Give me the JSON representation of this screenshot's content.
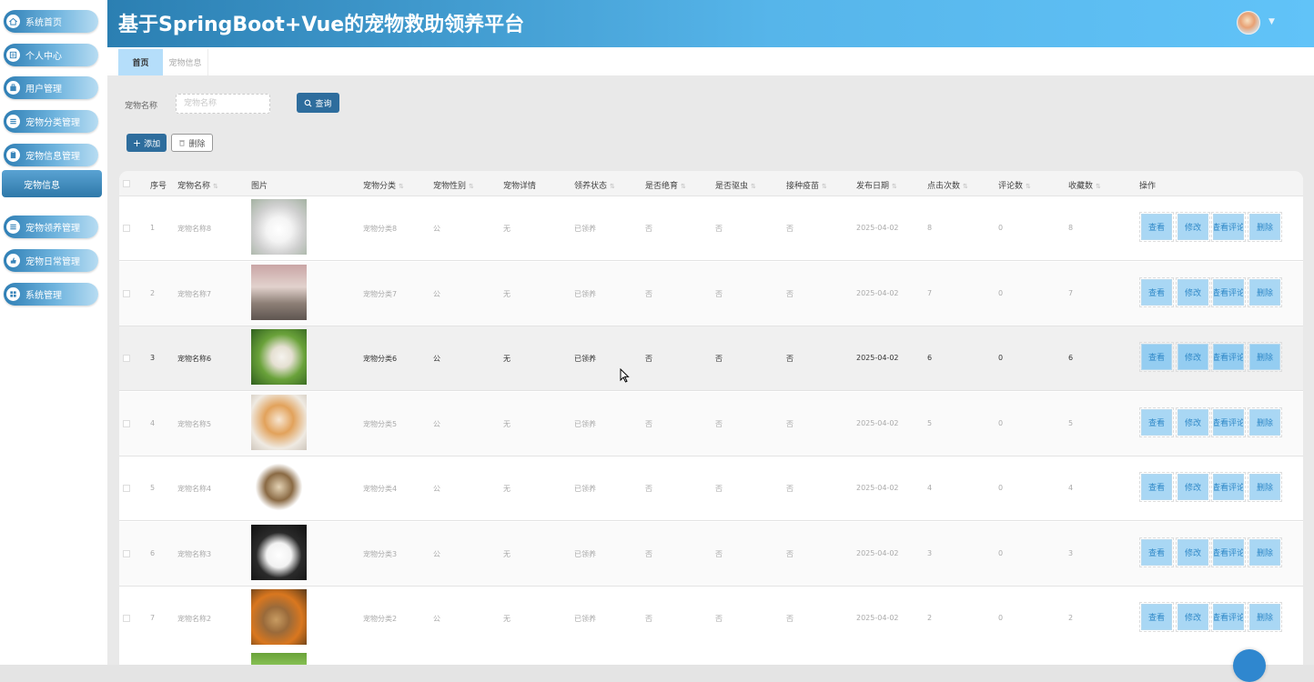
{
  "app": {
    "title": "基于SpringBoot+Vue的宠物救助领养平台"
  },
  "sidebar": {
    "items": [
      {
        "label": "系统首页",
        "icon": "home-icon"
      },
      {
        "label": "个人中心",
        "icon": "profile-icon"
      },
      {
        "label": "用户管理",
        "icon": "user-icon"
      },
      {
        "label": "宠物分类管理",
        "icon": "list-icon"
      },
      {
        "label": "宠物信息管理",
        "icon": "clipboard-icon"
      },
      {
        "label": "宠物信息",
        "icon": "",
        "active": true
      },
      {
        "label": "宠物领养管理",
        "icon": "list-icon"
      },
      {
        "label": "宠物日常管理",
        "icon": "thumb-icon"
      },
      {
        "label": "系统管理",
        "icon": "grid-icon"
      }
    ]
  },
  "tabs": [
    {
      "label": "首页",
      "active": true
    },
    {
      "label": "宠物信息",
      "active": false
    }
  ],
  "search": {
    "label": "宠物名称",
    "placeholder": "宠物名称",
    "button": "查询"
  },
  "toolbar": {
    "add": "添加",
    "delete": "删除"
  },
  "table": {
    "headers": [
      "序号",
      "宠物名称",
      "图片",
      "宠物分类",
      "宠物性别",
      "宠物详情",
      "领养状态",
      "是否绝育",
      "是否驱虫",
      "接种疫苗",
      "发布日期",
      "点击次数",
      "评论数",
      "收藏数",
      "操作"
    ],
    "actions": [
      "查看",
      "修改",
      "查看评论",
      "删除"
    ],
    "rows": [
      {
        "no": "1",
        "name": "宠物名称8",
        "category": "宠物分类8",
        "gender": "公",
        "detail": "无",
        "status": "已领养",
        "neutered": "否",
        "dewormed": "否",
        "vaccinated": "否",
        "date": "2025-04-02",
        "clicks": "8",
        "comments": "0",
        "favorites": "8"
      },
      {
        "no": "2",
        "name": "宠物名称7",
        "category": "宠物分类7",
        "gender": "公",
        "detail": "无",
        "status": "已领养",
        "neutered": "否",
        "dewormed": "否",
        "vaccinated": "否",
        "date": "2025-04-02",
        "clicks": "7",
        "comments": "0",
        "favorites": "7"
      },
      {
        "no": "3",
        "name": "宠物名称6",
        "category": "宠物分类6",
        "gender": "公",
        "detail": "无",
        "status": "已领养",
        "neutered": "否",
        "dewormed": "否",
        "vaccinated": "否",
        "date": "2025-04-02",
        "clicks": "6",
        "comments": "0",
        "favorites": "6"
      },
      {
        "no": "4",
        "name": "宠物名称5",
        "category": "宠物分类5",
        "gender": "公",
        "detail": "无",
        "status": "已领养",
        "neutered": "否",
        "dewormed": "否",
        "vaccinated": "否",
        "date": "2025-04-02",
        "clicks": "5",
        "comments": "0",
        "favorites": "5"
      },
      {
        "no": "5",
        "name": "宠物名称4",
        "category": "宠物分类4",
        "gender": "公",
        "detail": "无",
        "status": "已领养",
        "neutered": "否",
        "dewormed": "否",
        "vaccinated": "否",
        "date": "2025-04-02",
        "clicks": "4",
        "comments": "0",
        "favorites": "4"
      },
      {
        "no": "6",
        "name": "宠物名称3",
        "category": "宠物分类3",
        "gender": "公",
        "detail": "无",
        "status": "已领养",
        "neutered": "否",
        "dewormed": "否",
        "vaccinated": "否",
        "date": "2025-04-02",
        "clicks": "3",
        "comments": "0",
        "favorites": "3"
      },
      {
        "no": "7",
        "name": "宠物名称2",
        "category": "宠物分类2",
        "gender": "公",
        "detail": "无",
        "status": "已领养",
        "neutered": "否",
        "dewormed": "否",
        "vaccinated": "否",
        "date": "2025-04-02",
        "clicks": "2",
        "comments": "0",
        "favorites": "2"
      }
    ]
  },
  "colors": {
    "header_start": "#2b7fb2",
    "header_end": "#61c3f8",
    "primary_button": "#2e6d9d",
    "action_button": "#a9d7f4"
  }
}
